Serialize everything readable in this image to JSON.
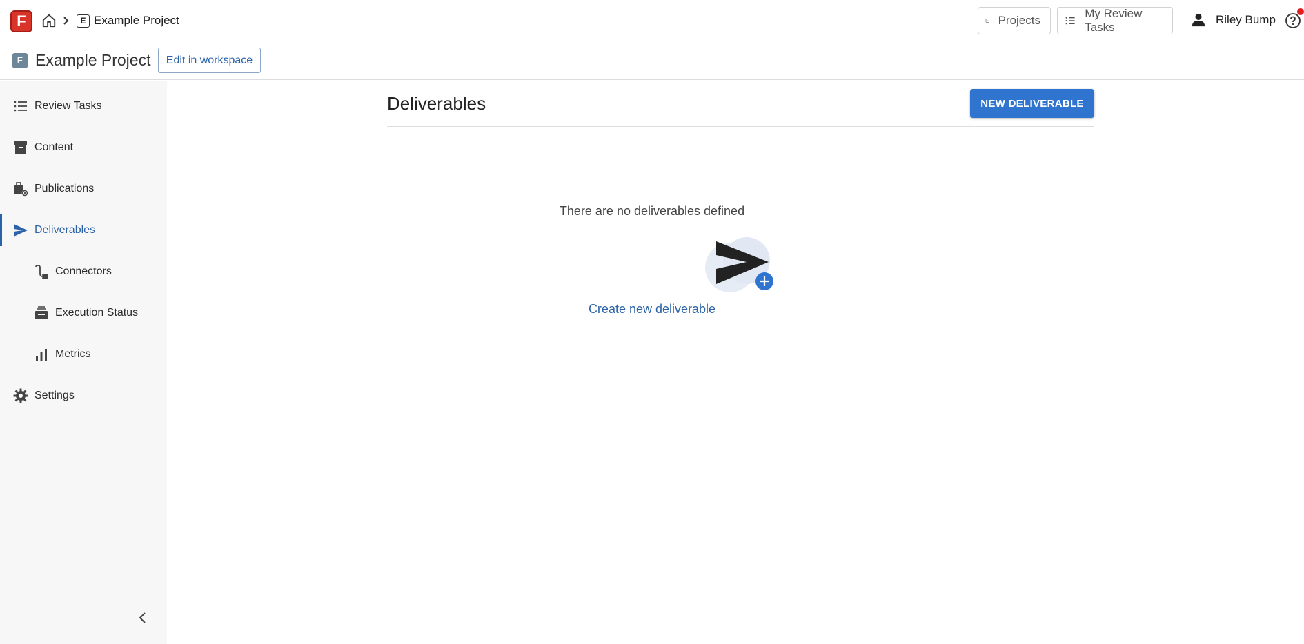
{
  "app": {
    "logo_letter": "F",
    "accent_color": "#2f74cf",
    "notification_color": "#e02020"
  },
  "topbar": {
    "breadcrumb_badge": "E",
    "breadcrumb_project": "Example Project",
    "projects_label": "Projects",
    "my_review_tasks_label": "My Review Tasks",
    "user_name": "Riley Bump"
  },
  "project": {
    "badge": "E",
    "title": "Example Project",
    "edit_label": "Edit in workspace"
  },
  "sidebar": {
    "items": [
      {
        "label": "Review Tasks",
        "icon": "list-icon"
      },
      {
        "label": "Content",
        "icon": "archive-icon"
      },
      {
        "label": "Publications",
        "icon": "publications-gear-icon"
      },
      {
        "label": "Deliverables",
        "icon": "send-icon",
        "active": true
      },
      {
        "label": "Connectors",
        "icon": "connector-icon"
      },
      {
        "label": "Execution Status",
        "icon": "execution-status-icon"
      },
      {
        "label": "Metrics",
        "icon": "bar-chart-icon"
      },
      {
        "label": "Settings",
        "icon": "gear-icon"
      }
    ]
  },
  "main": {
    "title": "Deliverables",
    "new_button_label": "NEW DELIVERABLE",
    "empty_message": "There are no deliverables defined",
    "create_link_label": "Create new deliverable"
  }
}
